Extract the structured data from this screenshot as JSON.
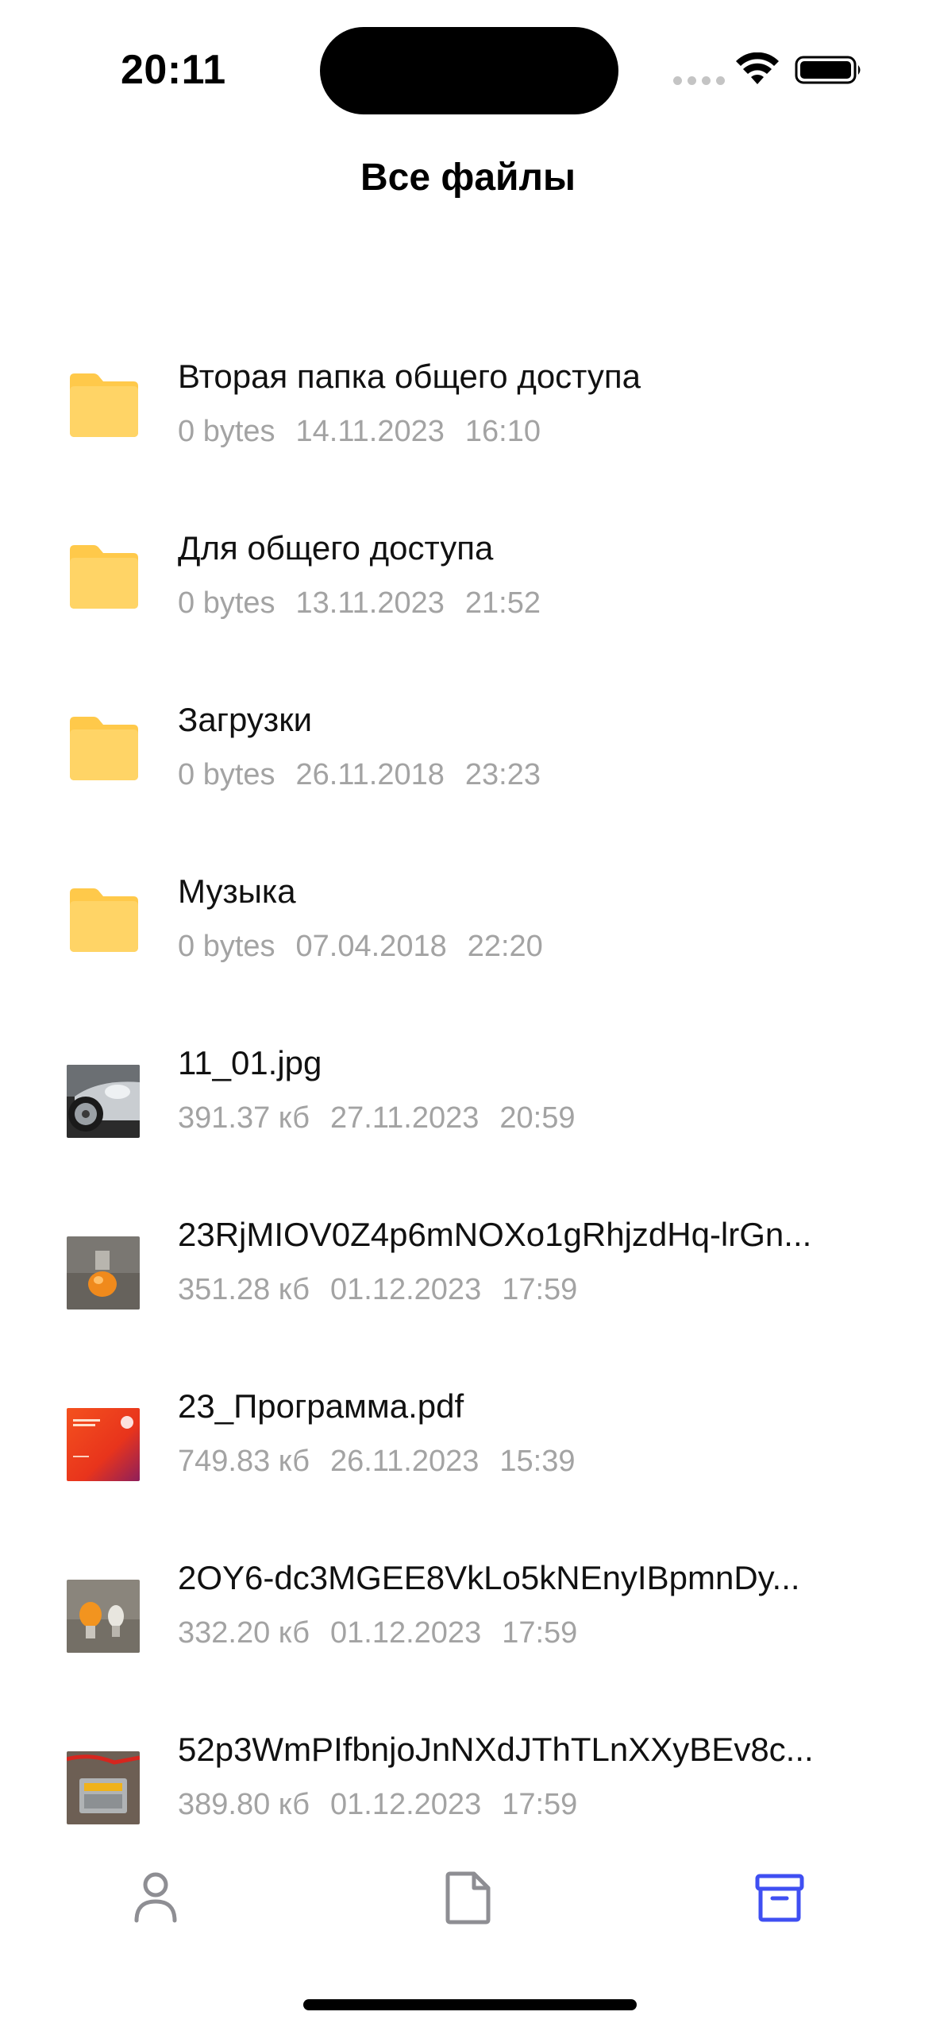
{
  "status_bar": {
    "time": "20:11"
  },
  "header": {
    "title": "Все файлы"
  },
  "files": [
    {
      "name": "Вторая папка общего доступа",
      "size": "0 bytes",
      "date": "14.11.2023",
      "time": "16:10",
      "icon": "folder-icon"
    },
    {
      "name": "Для общего доступа",
      "size": "0 bytes",
      "date": "13.11.2023",
      "time": "21:52",
      "icon": "folder-icon"
    },
    {
      "name": "Загрузки",
      "size": "0 bytes",
      "date": "26.11.2018",
      "time": "23:23",
      "icon": "folder-icon"
    },
    {
      "name": "Музыка",
      "size": "0 bytes",
      "date": "07.04.2018",
      "time": "22:20",
      "icon": "folder-icon"
    },
    {
      "name": "11_01.jpg",
      "size": "391.37 кб",
      "date": "27.11.2023",
      "time": "20:59",
      "icon": "image-thumbnail"
    },
    {
      "name": "23RjMIOV0Z4p6mNOXo1gRhjzdHq-lrGn...",
      "size": "351.28 кб",
      "date": "01.12.2023",
      "time": "17:59",
      "icon": "image-thumbnail"
    },
    {
      "name": "23_Программа.pdf",
      "size": "749.83 кб",
      "date": "26.11.2023",
      "time": "15:39",
      "icon": "pdf-thumbnail"
    },
    {
      "name": "2OY6-dc3MGEE8VkLo5kNEnyIBpmnDy...",
      "size": "332.20 кб",
      "date": "01.12.2023",
      "time": "17:59",
      "icon": "image-thumbnail"
    },
    {
      "name": "52p3WmPIfbnjoJnNXdJThTLnXXyBEv8c...",
      "size": "389.80 кб",
      "date": "01.12.2023",
      "time": "17:59",
      "icon": "image-thumbnail"
    }
  ],
  "tab_bar": {
    "items": [
      {
        "icon": "profile-icon",
        "active": false
      },
      {
        "icon": "document-icon",
        "active": false
      },
      {
        "icon": "archive-icon",
        "active": true
      }
    ],
    "active_color": "#3f4ff2",
    "inactive_color": "#8e8e93"
  },
  "colors": {
    "folder": "#ffc94a",
    "meta_text": "#a3a3a3"
  }
}
